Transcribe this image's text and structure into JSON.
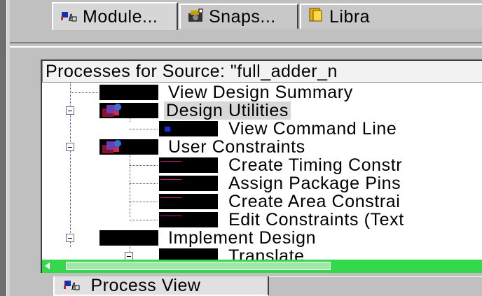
{
  "tabs": [
    {
      "label": "Module...",
      "icon": "module-view-icon"
    },
    {
      "label": "Snaps...",
      "icon": "snapshot-icon"
    },
    {
      "label": "Libra",
      "icon": "library-icon"
    }
  ],
  "panel": {
    "title": "Processes for Source:  \"full_adder_n",
    "tree": [
      {
        "label": "View Design Summary",
        "level": 1,
        "expandable": false,
        "selected": false,
        "icon": "process-icon"
      },
      {
        "label": "Design Utilities",
        "level": 1,
        "expandable": true,
        "selected": true,
        "icon": "utilities-icon"
      },
      {
        "label": "View Command Line",
        "level": 2,
        "expandable": false,
        "selected": false,
        "icon": "command-line-icon"
      },
      {
        "label": "User Constraints",
        "level": 1,
        "expandable": true,
        "selected": false,
        "icon": "constraints-icon"
      },
      {
        "label": "Create Timing Constr",
        "level": 2,
        "expandable": false,
        "selected": false,
        "icon": "process-icon"
      },
      {
        "label": "Assign Package Pins",
        "level": 2,
        "expandable": false,
        "selected": false,
        "icon": "process-icon"
      },
      {
        "label": "Create Area Constrai",
        "level": 2,
        "expandable": false,
        "selected": false,
        "icon": "process-icon"
      },
      {
        "label": "Edit Constraints (Text",
        "level": 2,
        "expandable": false,
        "selected": false,
        "icon": "process-icon"
      },
      {
        "label": "Implement Design",
        "level": 1,
        "expandable": true,
        "selected": false,
        "icon": "process-icon"
      },
      {
        "label": "Translate",
        "level": 2,
        "expandable": true,
        "selected": false,
        "icon": "process-icon"
      }
    ]
  },
  "bottom_tab": {
    "label": "Process View",
    "icon": "process-view-icon"
  },
  "colors": {
    "scrollbar": "#33d94a",
    "background": "#c0c0c0",
    "selection": "#d8d8d8"
  }
}
